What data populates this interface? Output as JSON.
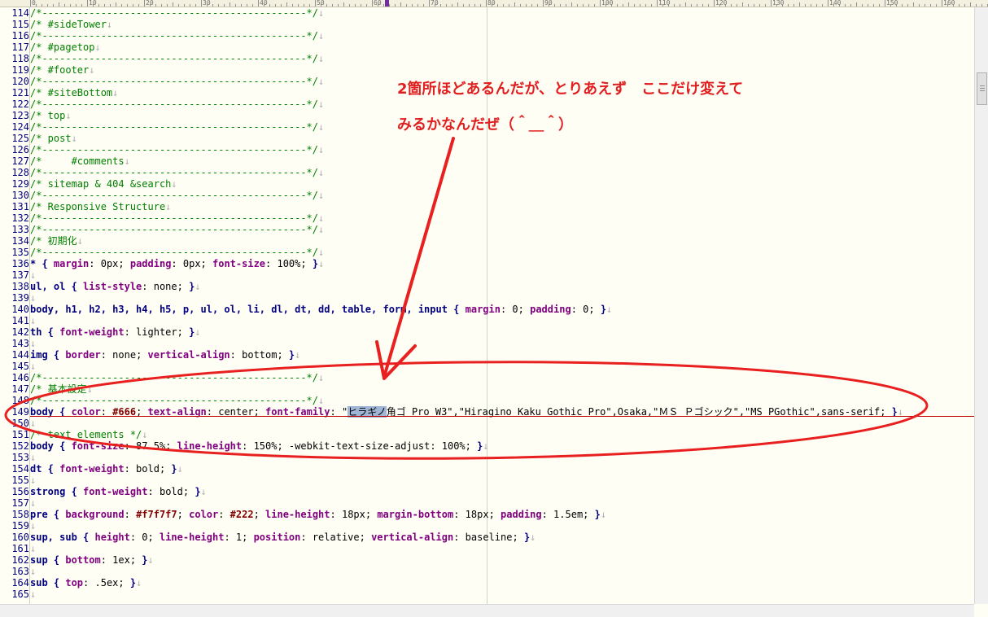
{
  "ruler": {
    "labels": [
      "0",
      "10",
      "20",
      "30",
      "40",
      "50",
      "60",
      "70",
      "80",
      "90",
      "100",
      "110",
      "120",
      "130",
      "140",
      "150",
      "160"
    ]
  },
  "lines": [
    {
      "n": "114",
      "t": [
        [
          "c",
          "/*---------------------------------------------*/"
        ]
      ]
    },
    {
      "n": "115",
      "t": [
        [
          "c",
          "/* #sideTower"
        ]
      ]
    },
    {
      "n": "116",
      "t": [
        [
          "c",
          "/*---------------------------------------------*/"
        ]
      ]
    },
    {
      "n": "117",
      "t": [
        [
          "c",
          "/* #pagetop"
        ]
      ]
    },
    {
      "n": "118",
      "t": [
        [
          "c",
          "/*---------------------------------------------*/"
        ]
      ]
    },
    {
      "n": "119",
      "t": [
        [
          "c",
          "/* #footer"
        ]
      ]
    },
    {
      "n": "120",
      "t": [
        [
          "c",
          "/*---------------------------------------------*/"
        ]
      ]
    },
    {
      "n": "121",
      "t": [
        [
          "c",
          "/* #siteBottom"
        ]
      ]
    },
    {
      "n": "122",
      "t": [
        [
          "c",
          "/*---------------------------------------------*/"
        ]
      ]
    },
    {
      "n": "123",
      "t": [
        [
          "c",
          "/* top"
        ]
      ]
    },
    {
      "n": "124",
      "t": [
        [
          "c",
          "/*---------------------------------------------*/"
        ]
      ]
    },
    {
      "n": "125",
      "t": [
        [
          "c",
          "/* post"
        ]
      ]
    },
    {
      "n": "126",
      "t": [
        [
          "c",
          "/*---------------------------------------------*/"
        ]
      ]
    },
    {
      "n": "127",
      "t": [
        [
          "c",
          "/*     #comments"
        ]
      ]
    },
    {
      "n": "128",
      "t": [
        [
          "c",
          "/*---------------------------------------------*/"
        ]
      ]
    },
    {
      "n": "129",
      "t": [
        [
          "c",
          "/* sitemap & 404 &search"
        ]
      ]
    },
    {
      "n": "130",
      "t": [
        [
          "c",
          "/*---------------------------------------------*/"
        ]
      ]
    },
    {
      "n": "131",
      "t": [
        [
          "c",
          "/* Responsive Structure"
        ]
      ]
    },
    {
      "n": "132",
      "t": [
        [
          "c",
          "/*---------------------------------------------*/"
        ]
      ]
    },
    {
      "n": "133",
      "t": [
        [
          "c",
          "/*---------------------------------------------*/"
        ]
      ]
    },
    {
      "n": "134",
      "t": [
        [
          "c",
          "/* 初期化"
        ]
      ]
    },
    {
      "n": "135",
      "t": [
        [
          "c",
          "/*---------------------------------------------*/"
        ]
      ]
    },
    {
      "n": "136",
      "t": [
        [
          "sel",
          "* { "
        ],
        [
          "prop",
          "margin"
        ],
        [
          "str",
          ": 0px; "
        ],
        [
          "prop",
          "padding"
        ],
        [
          "str",
          ": 0px; "
        ],
        [
          "prop",
          "font-size"
        ],
        [
          "str",
          ": 100%; "
        ],
        [
          "sel",
          "}"
        ]
      ]
    },
    {
      "n": "137",
      "t": []
    },
    {
      "n": "138",
      "t": [
        [
          "sel",
          "ul, ol { "
        ],
        [
          "prop",
          "list-style"
        ],
        [
          "str",
          ": none; "
        ],
        [
          "sel",
          "}"
        ]
      ]
    },
    {
      "n": "139",
      "t": []
    },
    {
      "n": "140",
      "t": [
        [
          "sel",
          "body, h1, h2, h3, h4, h5, p, ul, ol, li, dl, dt, dd, table, form, input { "
        ],
        [
          "prop",
          "margin"
        ],
        [
          "str",
          ": 0; "
        ],
        [
          "prop",
          "padding"
        ],
        [
          "str",
          ": 0; "
        ],
        [
          "sel",
          "}"
        ]
      ]
    },
    {
      "n": "141",
      "t": []
    },
    {
      "n": "142",
      "t": [
        [
          "sel",
          "th { "
        ],
        [
          "prop",
          "font-weight"
        ],
        [
          "str",
          ": lighter; "
        ],
        [
          "sel",
          "}"
        ]
      ]
    },
    {
      "n": "143",
      "t": []
    },
    {
      "n": "144",
      "t": [
        [
          "sel",
          "img { "
        ],
        [
          "prop",
          "border"
        ],
        [
          "str",
          ": none; "
        ],
        [
          "prop",
          "vertical-align"
        ],
        [
          "str",
          ": bottom; "
        ],
        [
          "sel",
          "}"
        ]
      ]
    },
    {
      "n": "145",
      "t": []
    },
    {
      "n": "146",
      "t": [
        [
          "c",
          "/*---------------------------------------------*/"
        ]
      ]
    },
    {
      "n": "147",
      "t": [
        [
          "c",
          "/* 基本設定"
        ]
      ]
    },
    {
      "n": "148",
      "t": [
        [
          "c",
          "/*---------------------------------------------*/"
        ]
      ]
    },
    {
      "n": "149",
      "t": [
        [
          "sel",
          "body { "
        ],
        [
          "prop",
          "color"
        ],
        [
          "str",
          ": "
        ],
        [
          "hex",
          "#666"
        ],
        [
          "str",
          "; "
        ],
        [
          "prop",
          "text-align"
        ],
        [
          "str",
          ": center; "
        ],
        [
          "prop",
          "font-family"
        ],
        [
          "str",
          ": \""
        ],
        [
          "hl",
          "ヒラギノ"
        ],
        [
          "str",
          "角ゴ Pro W3\",\"Hiragino Kaku Gothic Pro\",Osaka,\"ＭＳ Ｐゴシック\",\"MS PGothic\",sans-serif; "
        ],
        [
          "sel",
          "}"
        ]
      ]
    },
    {
      "n": "150",
      "t": []
    },
    {
      "n": "151",
      "t": [
        [
          "c",
          "/* text elements */"
        ]
      ]
    },
    {
      "n": "152",
      "t": [
        [
          "sel",
          "body { "
        ],
        [
          "prop",
          "font-size"
        ],
        [
          "str",
          ": 87.5%; "
        ],
        [
          "prop",
          "line-height"
        ],
        [
          "str",
          ": 150%; -webkit-text-size-adjust: 100%; "
        ],
        [
          "sel",
          "}"
        ]
      ]
    },
    {
      "n": "153",
      "t": []
    },
    {
      "n": "154",
      "t": [
        [
          "sel",
          "dt { "
        ],
        [
          "prop",
          "font-weight"
        ],
        [
          "str",
          ": bold; "
        ],
        [
          "sel",
          "}"
        ]
      ]
    },
    {
      "n": "155",
      "t": []
    },
    {
      "n": "156",
      "t": [
        [
          "sel",
          "strong { "
        ],
        [
          "prop",
          "font-weight"
        ],
        [
          "str",
          ": bold; "
        ],
        [
          "sel",
          "}"
        ]
      ]
    },
    {
      "n": "157",
      "t": []
    },
    {
      "n": "158",
      "t": [
        [
          "sel",
          "pre { "
        ],
        [
          "prop",
          "background"
        ],
        [
          "str",
          ": "
        ],
        [
          "hex",
          "#f7f7f7"
        ],
        [
          "str",
          "; "
        ],
        [
          "prop",
          "color"
        ],
        [
          "str",
          ": "
        ],
        [
          "hex",
          "#222"
        ],
        [
          "str",
          "; "
        ],
        [
          "prop",
          "line-height"
        ],
        [
          "str",
          ": 18px; "
        ],
        [
          "prop",
          "margin-bottom"
        ],
        [
          "str",
          ": 18px; "
        ],
        [
          "prop",
          "padding"
        ],
        [
          "str",
          ": 1.5em; "
        ],
        [
          "sel",
          "}"
        ]
      ]
    },
    {
      "n": "159",
      "t": []
    },
    {
      "n": "160",
      "t": [
        [
          "sel",
          "sup, sub { "
        ],
        [
          "prop",
          "height"
        ],
        [
          "str",
          ": 0; "
        ],
        [
          "prop",
          "line-height"
        ],
        [
          "str",
          ": 1; "
        ],
        [
          "prop",
          "position"
        ],
        [
          "str",
          ": relative; "
        ],
        [
          "prop",
          "vertical-align"
        ],
        [
          "str",
          ": baseline; "
        ],
        [
          "sel",
          "}"
        ]
      ]
    },
    {
      "n": "161",
      "t": []
    },
    {
      "n": "162",
      "t": [
        [
          "sel",
          "sup { "
        ],
        [
          "prop",
          "bottom"
        ],
        [
          "str",
          ": 1ex; "
        ],
        [
          "sel",
          "}"
        ]
      ]
    },
    {
      "n": "163",
      "t": []
    },
    {
      "n": "164",
      "t": [
        [
          "sel",
          "sub { "
        ],
        [
          "prop",
          "top"
        ],
        [
          "str",
          ": .5ex; "
        ],
        [
          "sel",
          "}"
        ]
      ]
    },
    {
      "n": "165",
      "t": []
    }
  ],
  "annotation": {
    "line1": "2箇所ほどあるんだが、とりあえず　ここだけ変えて",
    "line2": "みるかなんだぜ（＾＿＾）",
    "color": "#e02020"
  }
}
